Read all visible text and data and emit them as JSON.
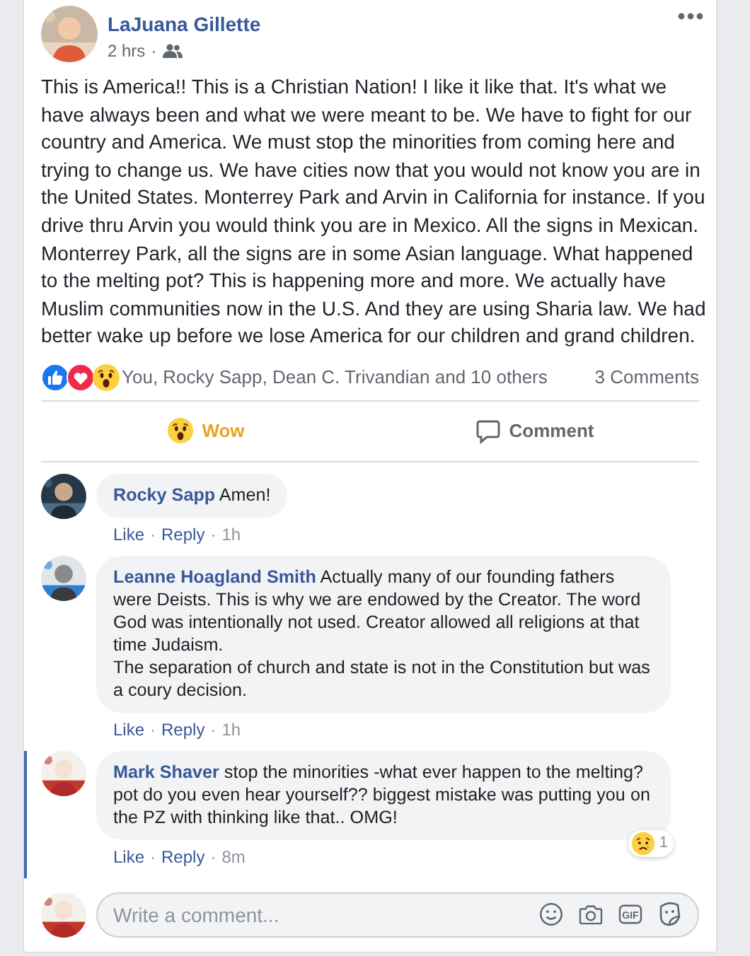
{
  "separator": "·",
  "post": {
    "author": "LaJuana Gillette",
    "time": "2 hrs",
    "text": "This is America!! This is a Christian Nation! I like it like that. It's what we have always been and what we were meant to be. We have to fight for our country and America. We must stop the minorities from coming here and trying to change us. We have cities now that you would not know you are in the United States. Monterrey Park and Arvin in California for instance. If you drive thru Arvin you would think you are in Mexico. All the signs in Mexican. Monterrey Park, all the signs are in some Asian language. What happened to the melting pot? This is happening more and more. We actually have Muslim communities now in the U.S. And they are using Sharia law. We had better wake up before we lose America for our children and grand children."
  },
  "reactions": {
    "icons": [
      {
        "kind": "like"
      },
      {
        "kind": "love"
      },
      {
        "kind": "wow"
      }
    ],
    "summary": "You, Rocky Sapp, Dean C. Trivandian and 10 others",
    "comments_count": "3 Comments"
  },
  "actions": [
    {
      "kind": "wow",
      "label": "Wow",
      "active": true
    },
    {
      "kind": "comment",
      "label": "Comment",
      "active": false
    }
  ],
  "comments": [
    {
      "author": "Rocky Sapp",
      "text": "Amen!",
      "like": "Like",
      "reply": "Reply",
      "time": "1h",
      "highlighted": false
    },
    {
      "author": "Leanne Hoagland Smith",
      "text": "Actually many of our founding fathers were Deists. This is why we are endowed by the Creator. The word God was intentionally not used. Creator allowed all religions at that time Judaism.\nThe separation of church and state is not in the Constitution but was a coury decision.",
      "like": "Like",
      "reply": "Reply",
      "time": "1h",
      "highlighted": false
    },
    {
      "author": "Mark Shaver",
      "text": "stop the minorities -what ever happen to the melting? pot do you even hear yourself?? biggest mistake was putting you on the PZ with thinking like that.. OMG!",
      "like": "Like",
      "reply": "Reply",
      "time": "8m",
      "highlighted": true,
      "reaction": {
        "kind": "sad",
        "count": "1"
      }
    }
  ],
  "composer": {
    "placeholder": "Write a comment...",
    "gif_label": "GIF"
  }
}
